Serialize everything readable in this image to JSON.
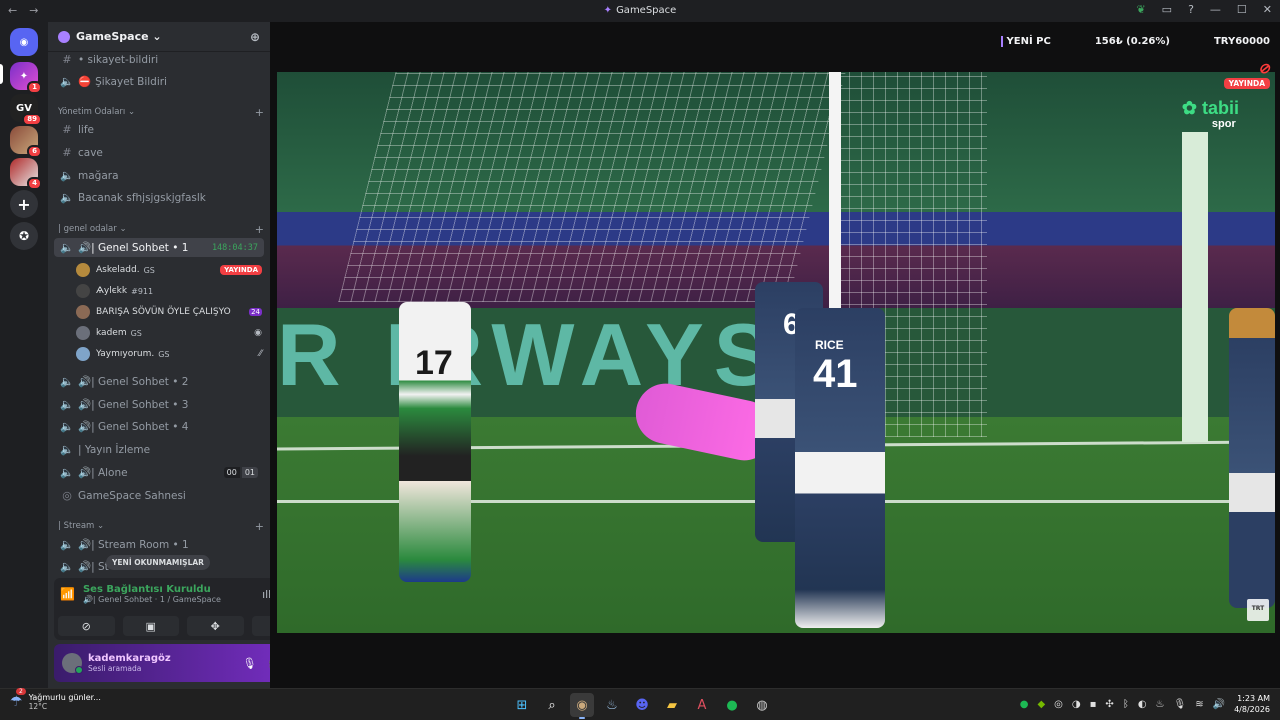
{
  "window": {
    "title": "GameSpace",
    "nav_back": "←",
    "nav_forward": "→",
    "controls": {
      "minimize": "—",
      "maximize": "☐",
      "close": "✕"
    }
  },
  "guilds": [
    {
      "name": "Discord home",
      "label": "◉",
      "badge": ""
    },
    {
      "name": "GameSpace",
      "label": "✦",
      "badge": "1"
    },
    {
      "name": "GV",
      "label": "GV",
      "badge": "89"
    },
    {
      "name": "guild-4",
      "label": "",
      "badge": "6"
    },
    {
      "name": "guild-5",
      "label": "",
      "badge": "4"
    }
  ],
  "server": {
    "name": "GameSpace ⌄"
  },
  "channels": {
    "sikayet_bildiri_top": "• sikayet-bildiri",
    "sikayet_bildir": "Şikayet Bildiri",
    "cat_yonetim": "Yönetim Odaları ⌄",
    "life": "life",
    "cave": "cave",
    "magara": "mağara",
    "bacanak": "Bacanak sfhjsjgskjgfaslk",
    "cat_genel": "| genel odalar ⌄",
    "genel_sohbet_1": "🔊| Genel Sohbet  • 1",
    "genel_sohbet_1_timer": "148:04:37",
    "genel_sohbet_2": "🔊| Genel Sohbet  • 2",
    "genel_sohbet_3": "🔊| Genel Sohbet  • 3",
    "genel_sohbet_4": "🔊| Genel Sohbet  • 4",
    "yayin_izleme": "| Yayın İzleme",
    "alone": "🔊| Alone",
    "alone_lim_a": "00",
    "alone_lim_b": "01",
    "sahnesi": "GameSpace Sahnesi",
    "cat_stream": "| Stream ⌄",
    "stream_room_1": "🔊| Stream Room  • 1",
    "stream_room_2": "🔊| St"
  },
  "voice_users": [
    {
      "name": "Askeladd.",
      "tag": "GS",
      "extra": "YAYINDA"
    },
    {
      "name": "Ѧуlєkk",
      "tag": "#911",
      "extra": ""
    },
    {
      "name": "BARIŞA SÖVÜN ÖYLE ÇALIŞYO",
      "tag": "",
      "extra": "24"
    },
    {
      "name": "kadem",
      "tag": "GS",
      "extra": "◉"
    },
    {
      "name": "Yaymıyorum.",
      "tag": "GS",
      "extra": "⁄⁄"
    }
  ],
  "unread_pill": "YENİ OKUNMAMIŞLAR",
  "voice_panel": {
    "title": "Ses Bağlantısı Kuruldu",
    "subtitle": "🔊| Genel Sohbet · 1 / GameSpace"
  },
  "user_panel": {
    "username": "kademkaragöz",
    "status": "Sesli aramada"
  },
  "ticker": {
    "item1": "YENİ PC",
    "item2": "156₺ (0.26%)",
    "item3": "TRY60000"
  },
  "stream": {
    "live_badge": "YAYINDA",
    "broadcaster_logo": "tabii",
    "broadcaster_sub": "spor",
    "ad_board": "R  IRWAYS",
    "corner_logo": "TRT",
    "jersey_17": "17",
    "jersey_6": "6",
    "jersey_41": "41",
    "name_rice": "RICE"
  },
  "taskbar": {
    "weather_title": "Yağmurlu günler...",
    "weather_temp": "12°C",
    "weather_badge": "2",
    "time": "1:23 AM",
    "date": "4/8/2026"
  },
  "colors": {
    "accent": "#a880ff",
    "green": "#3ba55d",
    "live_red": "#f23f43",
    "sidebar": "#2b2d31"
  }
}
